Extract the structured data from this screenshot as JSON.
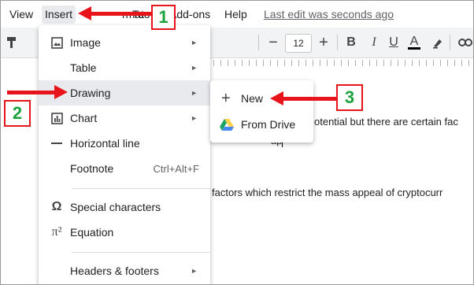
{
  "menubar": {
    "view": "View",
    "insert": "Insert",
    "format_partial": "rmat",
    "tools_partial": "Too",
    "addons": "Add-ons",
    "help": "Help",
    "last_edit": "Last edit was seconds ago"
  },
  "toolbar": {
    "font_size": "12",
    "minus": "−",
    "plus": "+",
    "bold": "B",
    "italic": "I",
    "underline": "U",
    "text_color": "A",
    "text_color_value": "#000000",
    "font_partial": "i"
  },
  "insert_menu": {
    "items": [
      {
        "label": "Image",
        "icon": "image-icon",
        "submenu": true
      },
      {
        "label": "Table",
        "icon": "",
        "submenu": true
      },
      {
        "label": "Drawing",
        "icon": "",
        "submenu": true
      },
      {
        "label": "Chart",
        "icon": "chart-icon",
        "submenu": true
      },
      {
        "label": "Horizontal line",
        "icon": "horizontal-line-icon",
        "submenu": false
      },
      {
        "label": "Footnote",
        "icon": "",
        "shortcut": "Ctrl+Alt+F"
      },
      {
        "label": "Special characters",
        "icon": "omega-icon",
        "submenu": false
      },
      {
        "label": "Equation",
        "icon": "pi-icon",
        "submenu": false
      },
      {
        "label": "Headers & footers",
        "icon": "",
        "submenu": true
      }
    ],
    "arrow_glyph": "►"
  },
  "drawing_submenu": {
    "new": "New",
    "from_drive": "From Drive"
  },
  "document": {
    "line1": "otential but there are certain fac",
    "line2": "ap",
    "line3": "factors which restrict the mass appeal of cryptocurr"
  },
  "annotations": {
    "step1": "1",
    "step2": "2",
    "step3": "3"
  },
  "colors": {
    "highlight": "#e8eaed",
    "annotation_red": "#e8141c",
    "annotation_green": "#1aa33c",
    "drive_green": "#1fa463",
    "drive_yellow": "#ffd04b",
    "drive_blue": "#4688f4"
  }
}
